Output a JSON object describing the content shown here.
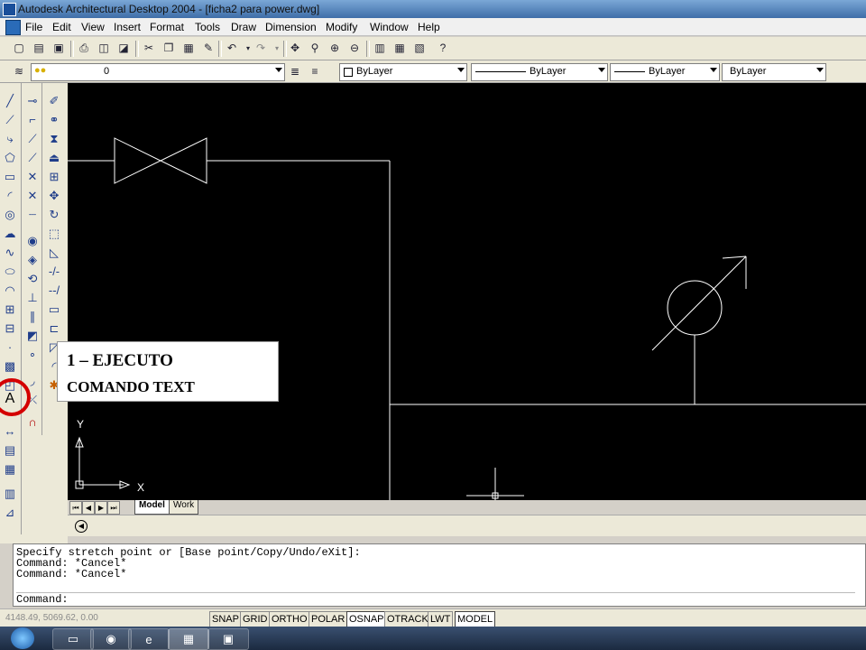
{
  "window": {
    "title": "Autodesk Architectural Desktop 2004 - [ficha2 para power.dwg]"
  },
  "menu": [
    "File",
    "Edit",
    "View",
    "Insert",
    "Format",
    "Tools",
    "Draw",
    "Dimension",
    "Modify",
    "Window",
    "Help"
  ],
  "layers": {
    "layer_value": "0",
    "color_value": "ByLayer",
    "linetype_value": "ByLayer",
    "lineweight_value": "ByLayer",
    "plotstyle_value": "ByLayer"
  },
  "layout_tabs": {
    "model": "Model",
    "work": "Work"
  },
  "command": {
    "lines": [
      "Specify stretch point or [Base point/Copy/Undo/eXit]:",
      "Command: *Cancel*",
      "Command: *Cancel*"
    ],
    "prompt": "Command:"
  },
  "status": {
    "coords": "4148.49, 5069.62, 0.00",
    "buttons": [
      "SNAP",
      "GRID",
      "ORTHO",
      "POLAR",
      "OSNAP",
      "OTRACK",
      "LWT",
      "MODEL"
    ]
  },
  "callout": {
    "line1": "1 – EJECUTO",
    "line2": "COMANDO  TEXT"
  },
  "tools": {
    "text_tool_glyph": "A"
  },
  "ucs": {
    "y": "Y",
    "x": "X"
  },
  "colors": {
    "canvas": "#000000",
    "drawing_lines": "#ffffff",
    "highlight_circle": "#d40000"
  }
}
